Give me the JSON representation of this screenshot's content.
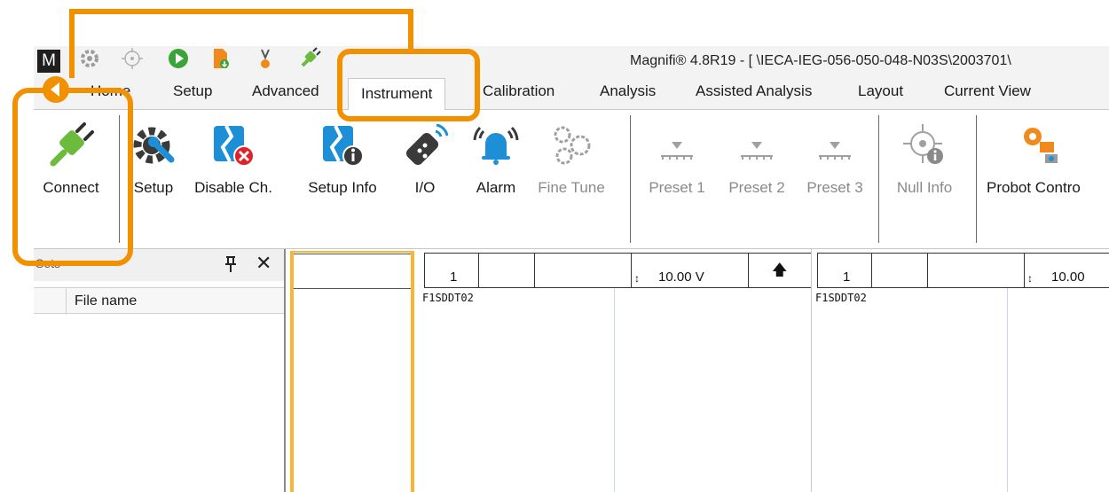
{
  "app": {
    "logo_letter": "M",
    "title": "Magnifi® 4.8R19 - [  \\IECA-IEG-056-050-048-N03S\\2003701\\"
  },
  "quick_access": {
    "icons": [
      "settings-icon",
      "target-icon",
      "play-icon",
      "file-export-icon",
      "probe-icon",
      "plug-icon"
    ],
    "dropdown_glyph": "▾"
  },
  "tabs": [
    {
      "label": "Home",
      "active": false
    },
    {
      "label": "Setup",
      "active": false
    },
    {
      "label": "Advanced",
      "active": false
    },
    {
      "label": "Instrument",
      "active": true
    },
    {
      "label": "Calibration",
      "active": false
    },
    {
      "label": "Analysis",
      "active": false
    },
    {
      "label": "Assisted Analysis",
      "active": false
    },
    {
      "label": "Layout",
      "active": false
    },
    {
      "label": "Current View",
      "active": false
    }
  ],
  "ribbon": {
    "buttons": [
      {
        "label": "Connect",
        "icon": "plug-icon",
        "enabled": true
      },
      {
        "label": "Setup",
        "icon": "setup-gear-wrench-icon",
        "enabled": true
      },
      {
        "label": "Disable Ch.",
        "icon": "disable-channel-icon",
        "enabled": true
      },
      {
        "label": "Setup Info",
        "icon": "setup-info-icon",
        "enabled": true
      },
      {
        "label": "I/O",
        "icon": "remote-io-icon",
        "enabled": true
      },
      {
        "label": "Alarm",
        "icon": "alarm-bell-icon",
        "enabled": true
      },
      {
        "label": "Fine Tune",
        "icon": "fine-tune-gears-icon",
        "enabled": false
      },
      {
        "label": "Preset 1",
        "icon": "preset-icon",
        "enabled": false
      },
      {
        "label": "Preset 2",
        "icon": "preset-icon",
        "enabled": false
      },
      {
        "label": "Preset 3",
        "icon": "preset-icon",
        "enabled": false
      },
      {
        "label": "Null Info",
        "icon": "null-info-icon",
        "enabled": false
      },
      {
        "label": "Probot Contro",
        "icon": "probot-control-icon",
        "enabled": true
      }
    ]
  },
  "left_pane": {
    "title": "Sets",
    "pin_glyph": "🖈",
    "close_glyph": "✕",
    "columns": [
      "",
      "File name"
    ]
  },
  "channels": [
    {
      "number": "1",
      "voltage": "10.00 V",
      "voltage_prefix": "↕",
      "arrow": "🡅",
      "label": "F1SDDT02"
    },
    {
      "number": "1",
      "voltage": "10.00",
      "voltage_prefix": "↕",
      "label": "F1SDDT02"
    }
  ],
  "colors": {
    "annotation_orange": "#f29100",
    "annotation_yellow": "#f7b733",
    "plug_green": "#6cbb3c",
    "icon_blue": "#1d8fd6",
    "icon_dark": "#3a3a3a"
  }
}
